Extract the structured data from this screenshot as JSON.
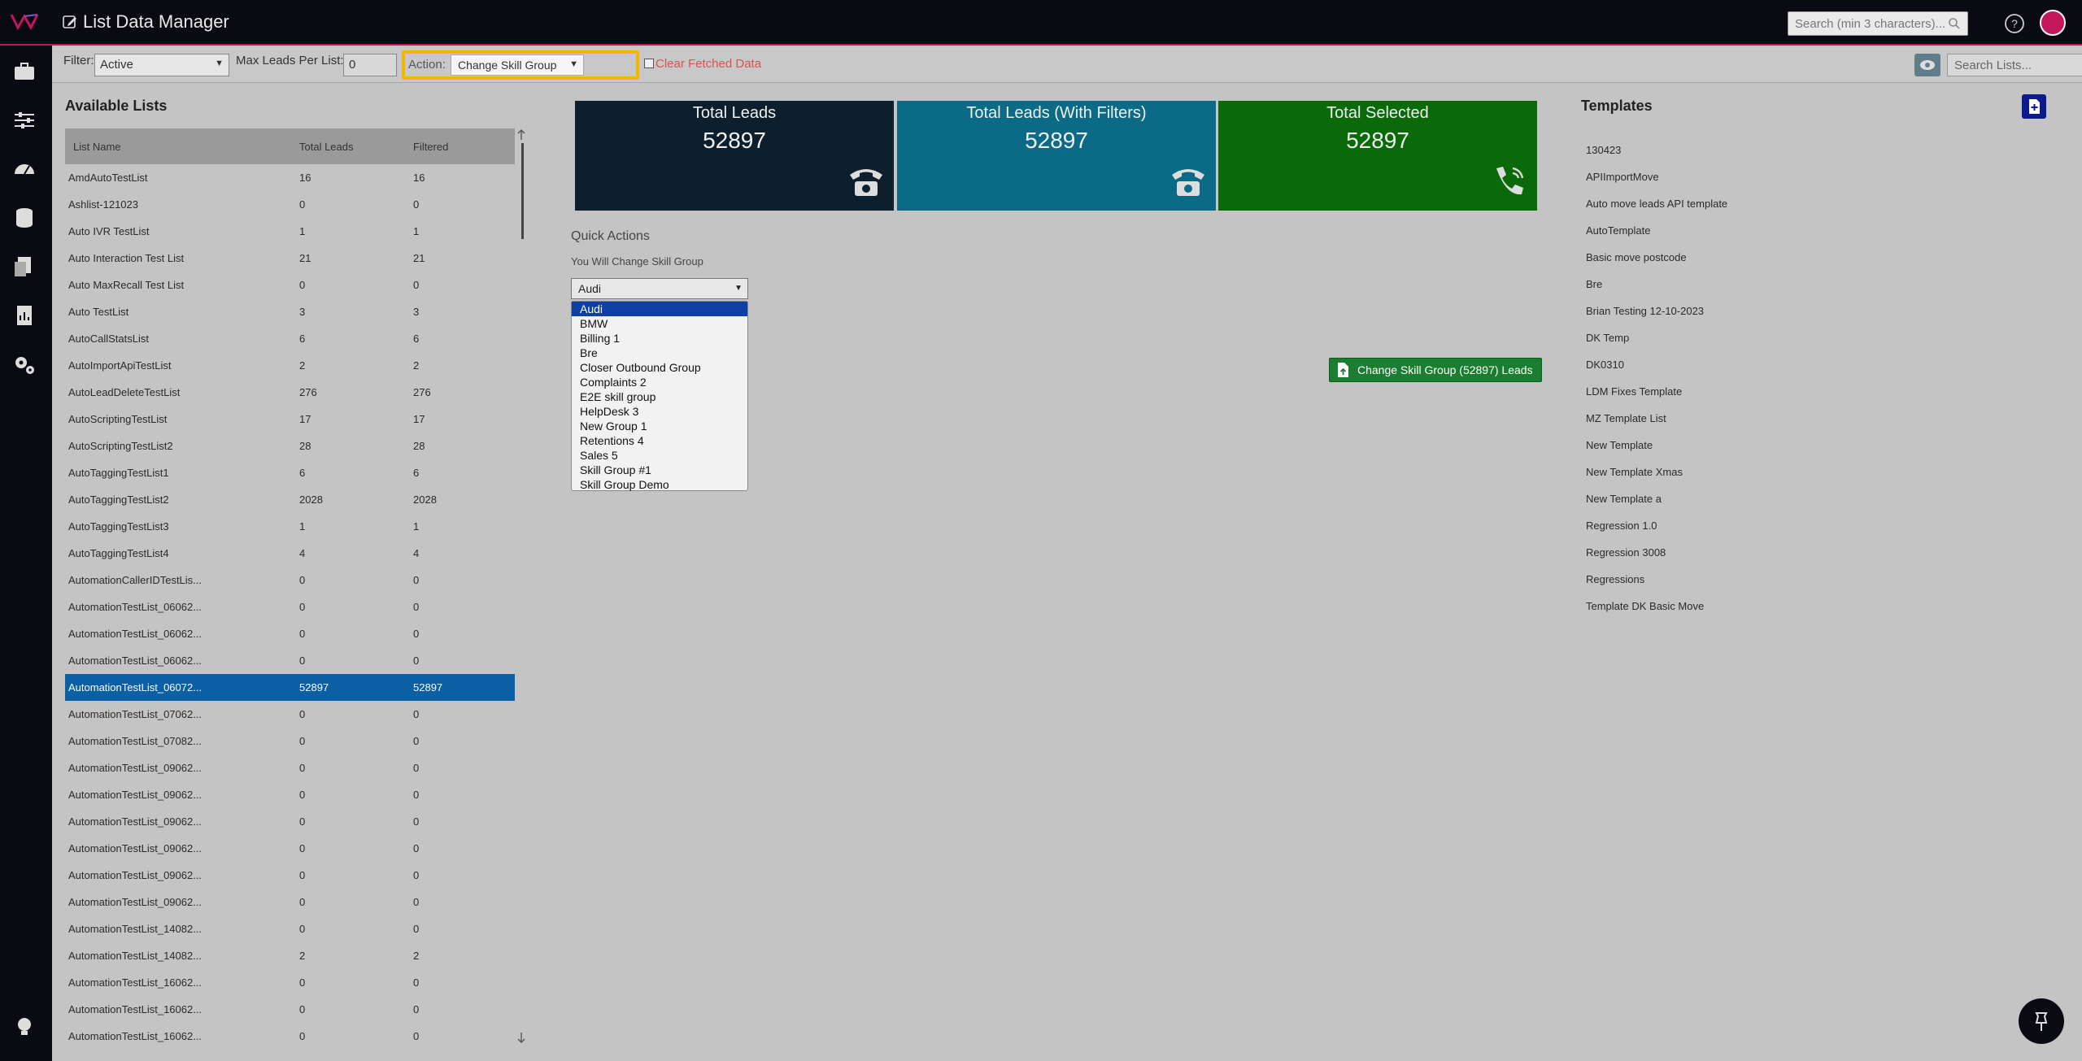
{
  "app": {
    "title": "List Data Manager"
  },
  "top_search": {
    "placeholder": "Search (min 3 characters)..."
  },
  "toolbar": {
    "filter_label": "Filter:",
    "filter_value": "Active",
    "max_leads_label": "Max Leads Per List:",
    "max_leads_value": "0",
    "action_label": "Action:",
    "action_value": "Change Skill Group",
    "clear_label": "Clear Fetched Data",
    "search_lists_placeholder": "Search Lists..."
  },
  "available_lists": {
    "title": "Available Lists",
    "headers": [
      "List Name",
      "Total Leads",
      "Filtered"
    ],
    "rows": [
      [
        "AmdAutoTestList",
        "16",
        "16"
      ],
      [
        "Ashlist-121023",
        "0",
        "0"
      ],
      [
        "Auto IVR TestList",
        "1",
        "1"
      ],
      [
        "Auto Interaction Test List",
        "21",
        "21"
      ],
      [
        "Auto MaxRecall Test List",
        "0",
        "0"
      ],
      [
        "Auto TestList",
        "3",
        "3"
      ],
      [
        "AutoCallStatsList",
        "6",
        "6"
      ],
      [
        "AutoImportApiTestList",
        "2",
        "2"
      ],
      [
        "AutoLeadDeleteTestList",
        "276",
        "276"
      ],
      [
        "AutoScriptingTestList",
        "17",
        "17"
      ],
      [
        "AutoScriptingTestList2",
        "28",
        "28"
      ],
      [
        "AutoTaggingTestList1",
        "6",
        "6"
      ],
      [
        "AutoTaggingTestList2",
        "2028",
        "2028"
      ],
      [
        "AutoTaggingTestList3",
        "1",
        "1"
      ],
      [
        "AutoTaggingTestList4",
        "4",
        "4"
      ],
      [
        "AutomationCallerIDTestLis...",
        "0",
        "0"
      ],
      [
        "AutomationTestList_06062...",
        "0",
        "0"
      ],
      [
        "AutomationTestList_06062...",
        "0",
        "0"
      ],
      [
        "AutomationTestList_06062...",
        "0",
        "0"
      ],
      [
        "AutomationTestList_06072...",
        "52897",
        "52897"
      ],
      [
        "AutomationTestList_07062...",
        "0",
        "0"
      ],
      [
        "AutomationTestList_07082...",
        "0",
        "0"
      ],
      [
        "AutomationTestList_09062...",
        "0",
        "0"
      ],
      [
        "AutomationTestList_09062...",
        "0",
        "0"
      ],
      [
        "AutomationTestList_09062...",
        "0",
        "0"
      ],
      [
        "AutomationTestList_09062...",
        "0",
        "0"
      ],
      [
        "AutomationTestList_09062...",
        "0",
        "0"
      ],
      [
        "AutomationTestList_09062...",
        "0",
        "0"
      ],
      [
        "AutomationTestList_14082...",
        "0",
        "0"
      ],
      [
        "AutomationTestList_14082...",
        "2",
        "2"
      ],
      [
        "AutomationTestList_16062...",
        "0",
        "0"
      ],
      [
        "AutomationTestList_16062...",
        "0",
        "0"
      ],
      [
        "AutomationTestList_16062...",
        "0",
        "0"
      ]
    ],
    "selected_index": 19
  },
  "cards": [
    {
      "title": "Total Leads",
      "value": "52897",
      "color": "#0d1f2d"
    },
    {
      "title": "Total Leads (With Filters)",
      "value": "52897",
      "color": "#0b6a85"
    },
    {
      "title": "Total Selected",
      "value": "52897",
      "color": "#0a6a0a"
    }
  ],
  "quick_actions": {
    "title": "Quick Actions",
    "subtitle": "You Will Change Skill Group",
    "selected": "Audi",
    "options": [
      "Audi",
      "BMW",
      "Billing 1",
      "Bre",
      "Closer Outbound Group",
      "Complaints 2",
      "E2E skill group",
      "HelpDesk 3",
      "New Group 1",
      "Retentions 4",
      "Sales 5",
      "Skill Group #1",
      "Skill Group Demo"
    ],
    "button_label": "Change Skill Group (52897) Leads"
  },
  "templates": {
    "title": "Templates",
    "items": [
      "130423",
      "APIImportMove",
      "Auto move leads API template",
      "AutoTemplate",
      "Basic move postcode",
      "Bre",
      "Brian Testing 12-10-2023",
      "DK Temp",
      "DK0310",
      "LDM Fixes Template",
      "MZ Template List",
      "New Template",
      "New Template Xmas",
      "New Template a",
      "Regression 1.0",
      "Regression 3008",
      "Regressions",
      "Template DK Basic Move"
    ]
  }
}
